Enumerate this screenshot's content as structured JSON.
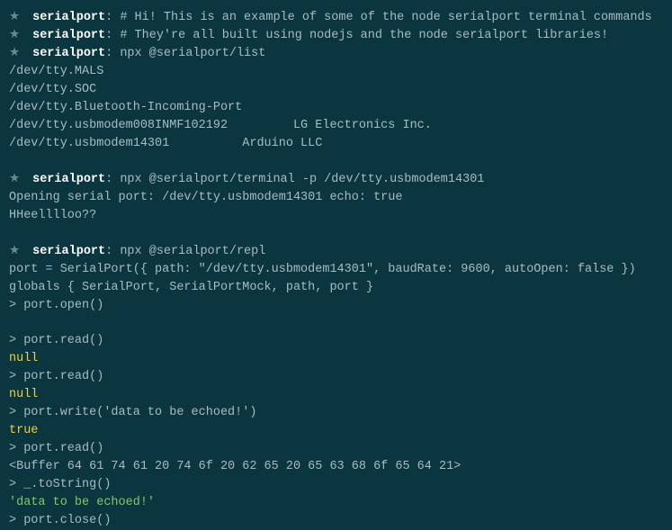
{
  "lines": [
    {
      "type": "prompt",
      "star": "★",
      "user": "serialport",
      "sep": ": ",
      "cmd": "# Hi! This is an example of some of the node serialport terminal commands"
    },
    {
      "type": "prompt",
      "star": "★",
      "user": "serialport",
      "sep": ": ",
      "cmd": "# They're all built using nodejs and the node serialport libraries!"
    },
    {
      "type": "prompt",
      "star": "★",
      "user": "serialport",
      "sep": ": ",
      "cmd": "npx @serialport/list"
    },
    {
      "type": "plain",
      "text": "/dev/tty.MALS"
    },
    {
      "type": "plain",
      "text": "/dev/tty.SOC"
    },
    {
      "type": "plain",
      "text": "/dev/tty.Bluetooth-Incoming-Port"
    },
    {
      "type": "plain",
      "text": "/dev/tty.usbmodem008INMF102192         LG Electronics Inc."
    },
    {
      "type": "plain",
      "text": "/dev/tty.usbmodem14301          Arduino LLC"
    },
    {
      "type": "plain",
      "text": ""
    },
    {
      "type": "prompt",
      "star": "★",
      "user": "serialport",
      "sep": ": ",
      "cmd": "npx @serialport/terminal -p /dev/tty.usbmodem14301"
    },
    {
      "type": "plain",
      "text": "Opening serial port: /dev/tty.usbmodem14301 echo: true"
    },
    {
      "type": "plain",
      "text": "HHeelllloo??"
    },
    {
      "type": "plain",
      "text": ""
    },
    {
      "type": "prompt",
      "star": "★",
      "user": "serialport",
      "sep": ": ",
      "cmd": "npx @serialport/repl"
    },
    {
      "type": "plain",
      "text": "port = SerialPort({ path: \"/dev/tty.usbmodem14301\", baudRate: 9600, autoOpen: false })"
    },
    {
      "type": "plain",
      "text": "globals { SerialPort, SerialPortMock, path, port }"
    },
    {
      "type": "plain",
      "text": "> port.open()"
    },
    {
      "type": "plain",
      "text": ""
    },
    {
      "type": "plain",
      "text": "> port.read()"
    },
    {
      "type": "yellow",
      "text": "null"
    },
    {
      "type": "plain",
      "text": "> port.read()"
    },
    {
      "type": "yellow",
      "text": "null"
    },
    {
      "type": "plain",
      "text": "> port.write('data to be echoed!')"
    },
    {
      "type": "yellow",
      "text": "true"
    },
    {
      "type": "plain",
      "text": "> port.read()"
    },
    {
      "type": "plain",
      "text": "<Buffer 64 61 74 61 20 74 6f 20 62 65 20 65 63 68 6f 65 64 21>"
    },
    {
      "type": "plain",
      "text": "> _.toString()"
    },
    {
      "type": "green",
      "text": "'data to be echoed!'"
    },
    {
      "type": "plain",
      "text": "> port.close()"
    }
  ]
}
